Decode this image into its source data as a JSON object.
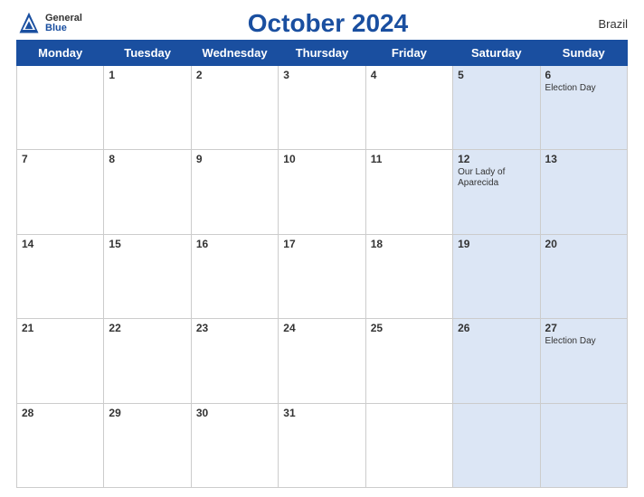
{
  "header": {
    "title": "October 2024",
    "country": "Brazil",
    "logo": {
      "general": "General",
      "blue": "Blue"
    }
  },
  "days_of_week": [
    "Monday",
    "Tuesday",
    "Wednesday",
    "Thursday",
    "Friday",
    "Saturday",
    "Sunday"
  ],
  "weeks": [
    [
      {
        "day": "",
        "event": ""
      },
      {
        "day": "1",
        "event": ""
      },
      {
        "day": "2",
        "event": ""
      },
      {
        "day": "3",
        "event": ""
      },
      {
        "day": "4",
        "event": ""
      },
      {
        "day": "5",
        "event": "",
        "weekend": true
      },
      {
        "day": "6",
        "event": "Election Day",
        "weekend": true
      }
    ],
    [
      {
        "day": "7",
        "event": ""
      },
      {
        "day": "8",
        "event": ""
      },
      {
        "day": "9",
        "event": ""
      },
      {
        "day": "10",
        "event": ""
      },
      {
        "day": "11",
        "event": ""
      },
      {
        "day": "12",
        "event": "Our Lady of Aparecida",
        "weekend": true
      },
      {
        "day": "13",
        "event": "",
        "weekend": true
      }
    ],
    [
      {
        "day": "14",
        "event": ""
      },
      {
        "day": "15",
        "event": ""
      },
      {
        "day": "16",
        "event": ""
      },
      {
        "day": "17",
        "event": ""
      },
      {
        "day": "18",
        "event": ""
      },
      {
        "day": "19",
        "event": "",
        "weekend": true
      },
      {
        "day": "20",
        "event": "",
        "weekend": true
      }
    ],
    [
      {
        "day": "21",
        "event": ""
      },
      {
        "day": "22",
        "event": ""
      },
      {
        "day": "23",
        "event": ""
      },
      {
        "day": "24",
        "event": ""
      },
      {
        "day": "25",
        "event": ""
      },
      {
        "day": "26",
        "event": "",
        "weekend": true
      },
      {
        "day": "27",
        "event": "Election Day",
        "weekend": true
      }
    ],
    [
      {
        "day": "28",
        "event": ""
      },
      {
        "day": "29",
        "event": ""
      },
      {
        "day": "30",
        "event": ""
      },
      {
        "day": "31",
        "event": ""
      },
      {
        "day": "",
        "event": ""
      },
      {
        "day": "",
        "event": "",
        "weekend": true
      },
      {
        "day": "",
        "event": "",
        "weekend": true
      }
    ]
  ]
}
